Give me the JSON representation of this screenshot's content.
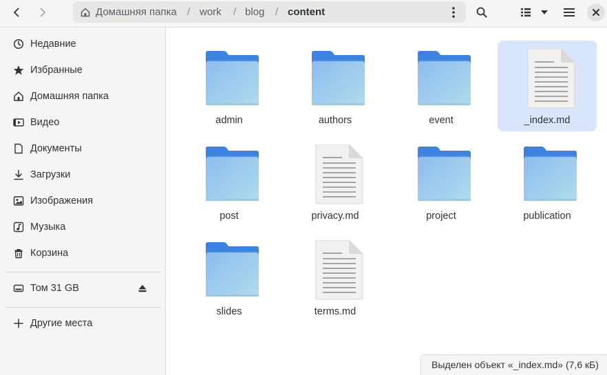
{
  "header": {
    "back_icon": "go-back-icon",
    "forward_icon": "go-forward-icon",
    "path": [
      {
        "label": "Домашняя папка",
        "icon": "home-icon"
      },
      {
        "label": "work"
      },
      {
        "label": "blog"
      },
      {
        "label": "content"
      }
    ],
    "separator": "/",
    "path_menu_icon": "vertical-ellipsis-icon",
    "search_icon": "search-icon",
    "view_icon": "list-view-icon",
    "view_menu_icon": "dropdown-arrow-icon",
    "main_menu_icon": "hamburger-menu-icon",
    "close_icon": "close-icon"
  },
  "sidebar": {
    "items": [
      {
        "label": "Недавние",
        "icon": "clock-icon"
      },
      {
        "label": "Избранные",
        "icon": "star-icon"
      },
      {
        "label": "Домашняя папка",
        "icon": "home-icon"
      },
      {
        "label": "Видео",
        "icon": "video-icon"
      },
      {
        "label": "Документы",
        "icon": "document-icon"
      },
      {
        "label": "Загрузки",
        "icon": "download-icon"
      },
      {
        "label": "Изображения",
        "icon": "image-icon"
      },
      {
        "label": "Музыка",
        "icon": "music-icon"
      },
      {
        "label": "Корзина",
        "icon": "trash-icon"
      }
    ],
    "drives": [
      {
        "label": "Том 31 GB",
        "icon": "drive-icon",
        "eject_icon": "eject-icon"
      }
    ],
    "other": {
      "label": "Другие места",
      "icon": "plus-icon"
    }
  },
  "files": [
    {
      "name": "admin",
      "type": "folder"
    },
    {
      "name": "authors",
      "type": "folder"
    },
    {
      "name": "event",
      "type": "folder"
    },
    {
      "name": "_index.md",
      "type": "text",
      "selected": true
    },
    {
      "name": "post",
      "type": "folder"
    },
    {
      "name": "privacy.md",
      "type": "text"
    },
    {
      "name": "project",
      "type": "folder"
    },
    {
      "name": "publication",
      "type": "folder"
    },
    {
      "name": "slides",
      "type": "folder"
    },
    {
      "name": "terms.md",
      "type": "text"
    }
  ],
  "status": {
    "text": "Выделен объект «_index.md» (7,6 кБ)"
  },
  "colors": {
    "folder_tab": "#3d82e0",
    "folder_body_top": "#8dbcf0",
    "folder_body_bottom": "#a9d4ec",
    "selection": "#d9e5fa"
  }
}
